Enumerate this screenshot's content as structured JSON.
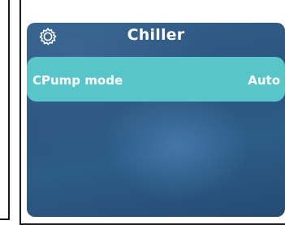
{
  "header": {
    "title": "Chiller",
    "icon": "gear-icon"
  },
  "settings": [
    {
      "label": "CPump mode",
      "value": "Auto"
    }
  ],
  "colors": {
    "row_background": "#58c6c8",
    "screen_background": "#2d5a85",
    "text": "#ffffff"
  }
}
